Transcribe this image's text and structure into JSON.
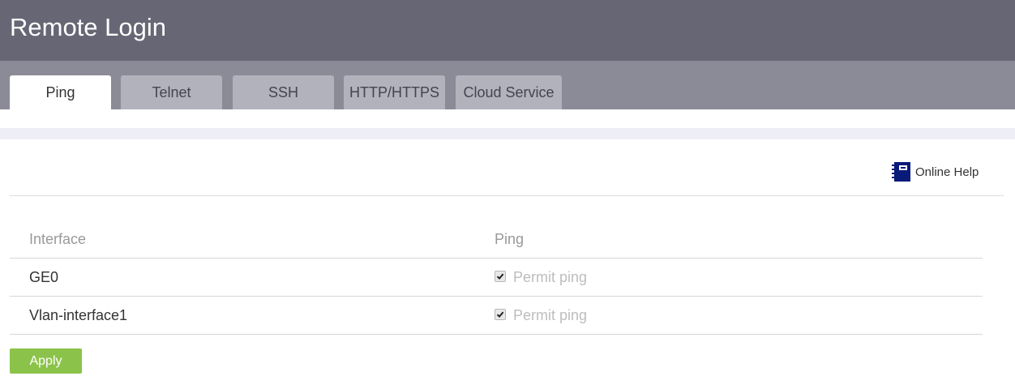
{
  "page": {
    "title": "Remote Login"
  },
  "tabs": [
    {
      "label": "Ping",
      "active": true
    },
    {
      "label": "Telnet",
      "active": false
    },
    {
      "label": "SSH",
      "active": false
    },
    {
      "label": "HTTP/HTTPS",
      "active": false
    },
    {
      "label": "Cloud Service",
      "active": false
    }
  ],
  "help": {
    "label": "Online Help",
    "icon": "help-book-icon"
  },
  "table": {
    "headers": [
      "Interface",
      "Ping"
    ],
    "rows": [
      {
        "interface": "GE0",
        "ping_label": "Permit ping",
        "checked": true
      },
      {
        "interface": "Vlan-interface1",
        "ping_label": "Permit ping",
        "checked": true
      }
    ]
  },
  "actions": {
    "apply_label": "Apply"
  },
  "colors": {
    "titlebar": "#666675",
    "tabbar": "#8b8b97",
    "tab_inactive": "#b2b2bd",
    "apply": "#8bc34a",
    "help_icon": "#0a1a78"
  }
}
